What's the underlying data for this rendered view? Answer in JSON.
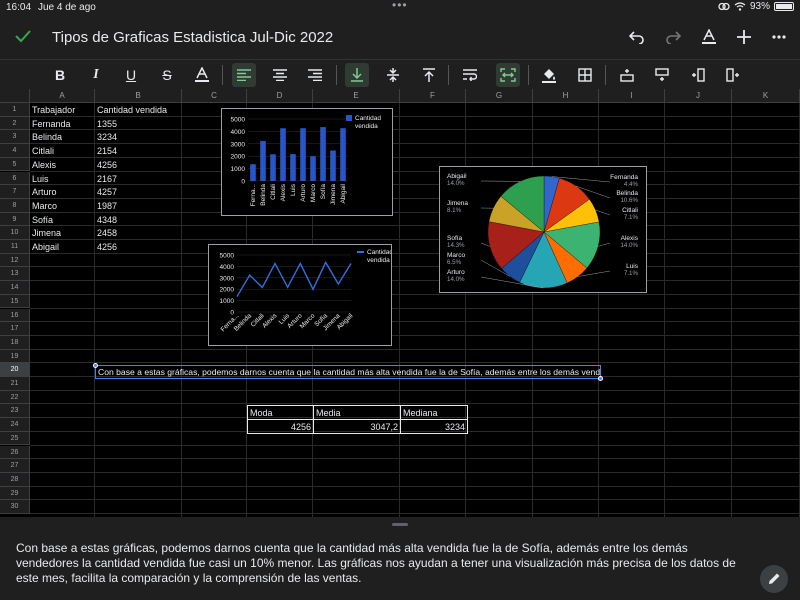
{
  "status": {
    "time": "16:04",
    "date": "Jue 4 de ago",
    "battery": "93%"
  },
  "document": {
    "title": "Tipos de Graficas Estadistica Jul-Dic 2022"
  },
  "toolbar": {
    "buttons": [
      "bold-icon",
      "italic-icon",
      "underline-icon",
      "strikethrough-icon",
      "text-color-icon",
      "align-left-icon",
      "align-center-icon",
      "align-right-icon",
      "valign-bottom-icon",
      "valign-middle-icon",
      "valign-top-icon",
      "wrap-text-icon",
      "merge-cells-icon",
      "fill-color-icon",
      "borders-icon",
      "insert-row-above-icon",
      "insert-row-below-icon",
      "insert-column-left-icon",
      "insert-column-right-icon"
    ]
  },
  "sheet": {
    "columns": [
      "A",
      "B",
      "C",
      "D",
      "E",
      "F",
      "G",
      "H",
      "I",
      "J",
      "K"
    ],
    "rows": [
      "1",
      "2",
      "3",
      "4",
      "5",
      "6",
      "7",
      "8",
      "9",
      "10",
      "11",
      "12",
      "13",
      "14",
      "15",
      "16",
      "17",
      "18",
      "19",
      "20",
      "21",
      "22",
      "23",
      "24",
      "25",
      "26",
      "27",
      "28",
      "29",
      "30"
    ],
    "headers": {
      "a1": "Trabajador",
      "b1": "Cantidad vendida"
    },
    "data": [
      {
        "name": "Fernanda",
        "value": "1355"
      },
      {
        "name": "Belinda",
        "value": "3234"
      },
      {
        "name": "Citlali",
        "value": "2154"
      },
      {
        "name": "Alexis",
        "value": "4256"
      },
      {
        "name": "Luis",
        "value": "2167"
      },
      {
        "name": "Arturo",
        "value": "4257"
      },
      {
        "name": "Marco",
        "value": "1987"
      },
      {
        "name": "Sofía",
        "value": "4348"
      },
      {
        "name": "Jimena",
        "value": "2458"
      },
      {
        "name": "Abigail",
        "value": "4256"
      }
    ],
    "note_cell": "Con base a estas gráficas, podemos darnos cuenta que la cantidad más alta vendida fue la de Sofía, además entre los demás vende",
    "stats": {
      "labels": [
        "Moda",
        "Media",
        "Mediana"
      ],
      "values": [
        "4256",
        "3047,2",
        "3234"
      ]
    }
  },
  "chart_data": [
    {
      "type": "bar",
      "categories": [
        "Fernanda",
        "Belinda",
        "Citlali",
        "Alexis",
        "Luis",
        "Arturo",
        "Marco",
        "Sofía",
        "Jimena",
        "Abigail"
      ],
      "tick_labels": [
        "Ferna...",
        "Belinda",
        "Citlali",
        "Alexis",
        "Luis",
        "Arturo",
        "Marco",
        "Sofía",
        "Jimena",
        "Abigail"
      ],
      "series": [
        {
          "name": "Cantidad vendida",
          "values": [
            1355,
            3234,
            2154,
            4256,
            2167,
            4257,
            1987,
            4348,
            2458,
            4256
          ]
        }
      ],
      "y_ticks": [
        "5000",
        "4000",
        "3000",
        "2000",
        "1000",
        "0"
      ],
      "ylim": [
        0,
        5000
      ],
      "legend": "top-right",
      "color": "#2956c7"
    },
    {
      "type": "line",
      "categories": [
        "Fernanda",
        "Belinda",
        "Citlali",
        "Alexis",
        "Luis",
        "Arturo",
        "Marco",
        "Sofía",
        "Jimena",
        "Abigail"
      ],
      "tick_labels": [
        "Ferna...",
        "Belinda",
        "Citlali",
        "Alexis",
        "Luis",
        "Arturo",
        "Marco",
        "Sofía",
        "Jimena",
        "Abigail"
      ],
      "series": [
        {
          "name": "Cantidad vendida",
          "values": [
            1355,
            3234,
            2154,
            4256,
            2167,
            4257,
            1987,
            4348,
            2458,
            4256
          ]
        }
      ],
      "y_ticks": [
        "5000",
        "4000",
        "3000",
        "2000",
        "1000",
        "0"
      ],
      "ylim": [
        0,
        5000
      ],
      "legend": "top-right",
      "color": "#2f6fe0"
    },
    {
      "type": "pie",
      "slices": [
        {
          "label": "Fernanda",
          "value": 1355,
          "pct": "4.4%",
          "color": "#3366cc"
        },
        {
          "label": "Belinda",
          "value": 3234,
          "pct": "10.6%",
          "color": "#dc3912"
        },
        {
          "label": "Citlali",
          "value": 2154,
          "pct": "7.1%",
          "color": "#ffc107"
        },
        {
          "label": "Alexis",
          "value": 4256,
          "pct": "14.0%",
          "color": "#3cb371"
        },
        {
          "label": "Luis",
          "value": 2167,
          "pct": "7.1%",
          "color": "#ff6d00"
        },
        {
          "label": "Arturo",
          "value": 4257,
          "pct": "14.0%",
          "color": "#26a5b5"
        },
        {
          "label": "Marco",
          "value": 1987,
          "pct": "6.5%",
          "color": "#1f4e9c"
        },
        {
          "label": "Sofía",
          "value": 4348,
          "pct": "14.3%",
          "color": "#a8201a"
        },
        {
          "label": "Jimena",
          "value": 2458,
          "pct": "8.1%",
          "color": "#c9a227"
        },
        {
          "label": "Abigail",
          "value": 4256,
          "pct": "14.0%",
          "color": "#2e9e4f"
        }
      ]
    }
  ],
  "editor": {
    "text": "Con base a estas gráficas, podemos darnos cuenta que la cantidad más alta vendida fue la de Sofía, además entre los demás vendedores la cantidad vendida fue casi un 10% menor. Las gráficas nos ayudan a tener una visualización más precisa de los datos de este mes, facilita la comparación y la comprensión de las ventas."
  }
}
